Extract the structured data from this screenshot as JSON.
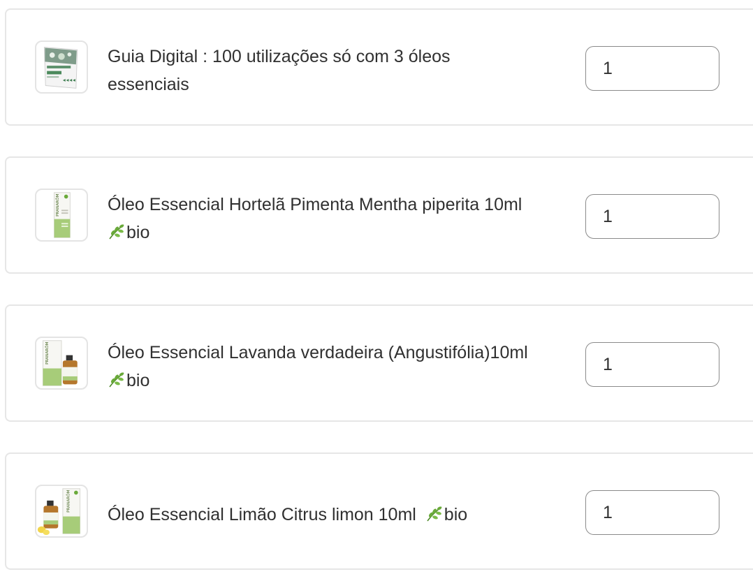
{
  "cart": {
    "items": [
      {
        "title_line1": "Guia Digital : 100 utilizações só com 3 óleos",
        "title_line2": "essenciais",
        "quantity": "1",
        "thumbnail_icon": "ebook-cover-icon"
      },
      {
        "title_line1": "Óleo Essencial Hortelã Pimenta Mentha piperita 10ml",
        "title_line2": "bio",
        "quantity": "1",
        "thumbnail_icon": "pranarom-box-icon"
      },
      {
        "title_line1": "Óleo Essencial Lavanda verdadeira (Angustifólia)10ml",
        "title_line2": "bio",
        "quantity": "1",
        "thumbnail_icon": "pranarom-box-bottle-icon"
      },
      {
        "title_line1": "Óleo Essencial Limão Citrus limon 10ml",
        "title_suffix": "bio",
        "quantity": "1",
        "thumbnail_icon": "pranarom-bottle-lemon-icon"
      }
    ]
  },
  "colors": {
    "card_border": "#e6e6e6",
    "input_border": "#8a8a8a",
    "text": "#303030",
    "leaf_green": "#6aaa3a"
  }
}
